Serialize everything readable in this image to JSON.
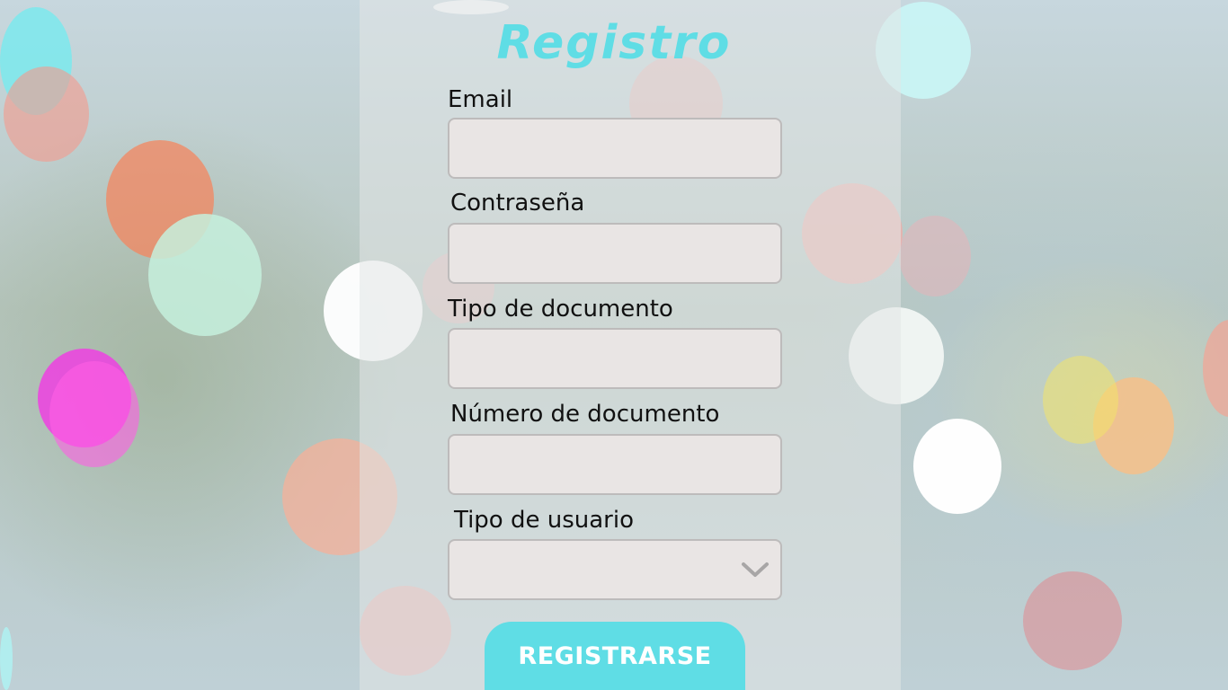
{
  "form": {
    "title": "Registro",
    "fields": [
      {
        "label": "Email",
        "value": "",
        "placeholder": ""
      },
      {
        "label": "Contraseña",
        "value": "",
        "placeholder": ""
      },
      {
        "label": "Tipo de documento",
        "value": "",
        "placeholder": ""
      },
      {
        "label": "Número de documento",
        "value": "",
        "placeholder": ""
      }
    ],
    "user_type": {
      "label": "Tipo de usuario",
      "selected": "",
      "icon": "chevron-down-icon"
    },
    "submit_label": "REGISTRARSE"
  },
  "colors": {
    "accent": "#5fdde5",
    "field_bg": "#e9e5e4",
    "field_border": "#bdbbbb",
    "label_text": "#111111",
    "button_text": "#ffffff"
  }
}
